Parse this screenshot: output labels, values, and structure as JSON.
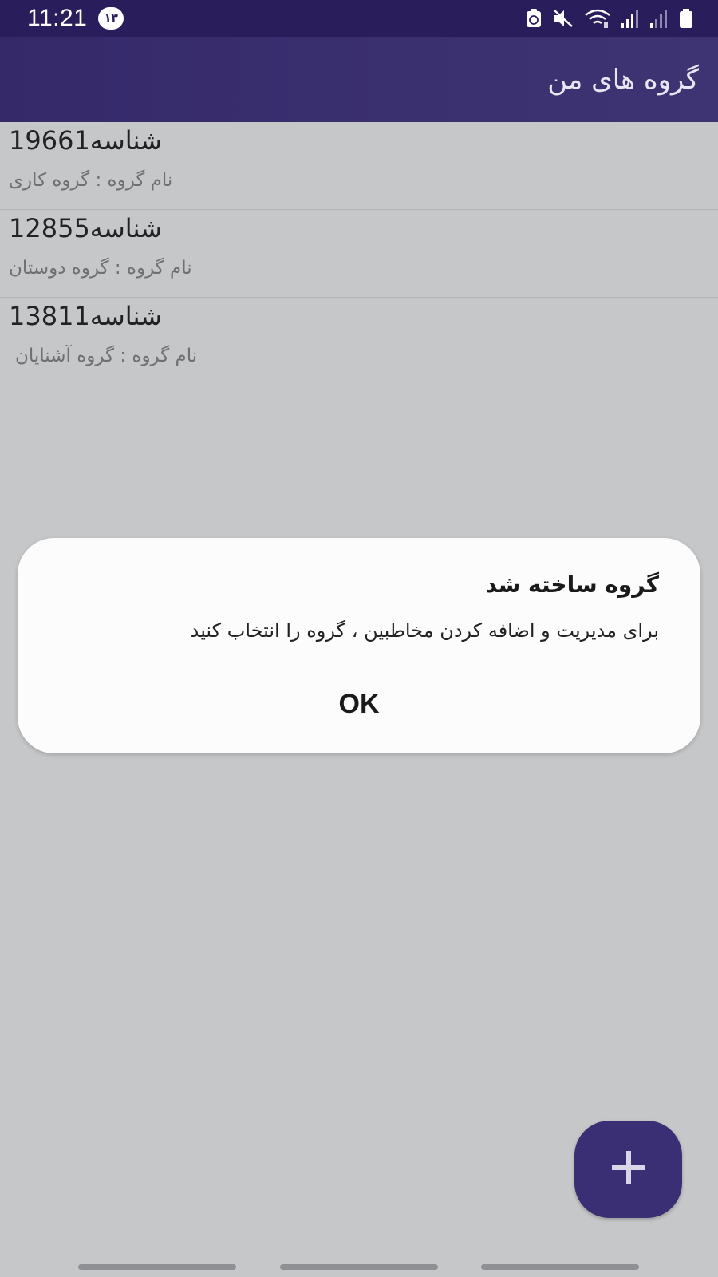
{
  "status_bar": {
    "time": "11:21",
    "notification_count": "۱۳",
    "icons": [
      "clipboard-recycle-icon",
      "mute-icon",
      "wifi-icon",
      "signal-icon",
      "signal-icon",
      "battery-icon"
    ]
  },
  "app_bar": {
    "title": "گروه های من"
  },
  "groups": [
    {
      "id_label": "شناسه19661",
      "name_label": "نام گروه :  گروه کاری"
    },
    {
      "id_label": "شناسه12855",
      "name_label": "نام گروه :  گروه دوستان"
    },
    {
      "id_label": "شناسه13811",
      "name_label": "نام گروه :  گروه آشنایان"
    }
  ],
  "dialog": {
    "title": "گروه ساخته شد",
    "message": "برای مدیریت و اضافه کردن مخاطبین ، گروه را انتخاب کنید",
    "ok_label": "OK"
  },
  "fab": {
    "icon": "plus-icon"
  },
  "colors": {
    "status_bar": "#2a1d5c",
    "app_bar": "#3a2f70",
    "scrim_background": "#c6c7c9",
    "dialog_background": "#fcfcfc",
    "fab": "#3a2f74"
  }
}
